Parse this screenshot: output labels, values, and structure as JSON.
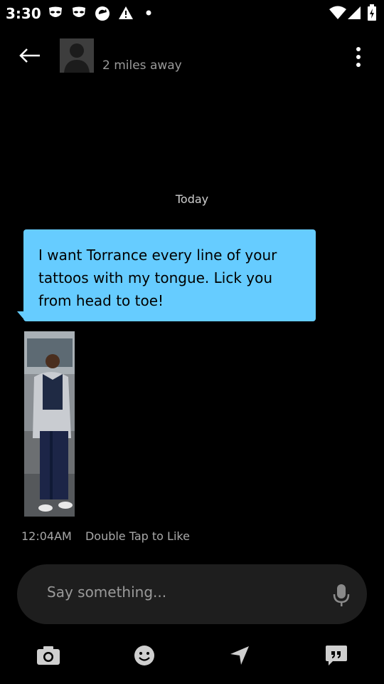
{
  "status": {
    "time": "3:30",
    "icons": [
      "mask-icon",
      "mask-icon",
      "sync-icon",
      "warning-icon",
      "dot-icon",
      "wifi-icon",
      "signal-icon",
      "battery-icon"
    ]
  },
  "header": {
    "back_icon": "back-arrow-icon",
    "distance": "2 miles away",
    "more_icon": "more-vertical-icon"
  },
  "chat": {
    "date_separator": "Today",
    "message": {
      "text": "I want Torrance every line of your tattoos with my tongue. Lick you from head to toe!",
      "time": "12:04AM",
      "like_hint": "Double Tap to Like"
    }
  },
  "composer": {
    "placeholder": "Say something...",
    "mic_icon": "microphone-icon"
  },
  "bottom_bar": {
    "items": [
      "camera-icon",
      "emoji-icon",
      "location-icon",
      "quote-icon"
    ]
  },
  "colors": {
    "bubble": "#66ccff",
    "background": "#000000",
    "composer": "#1e1e1e"
  }
}
